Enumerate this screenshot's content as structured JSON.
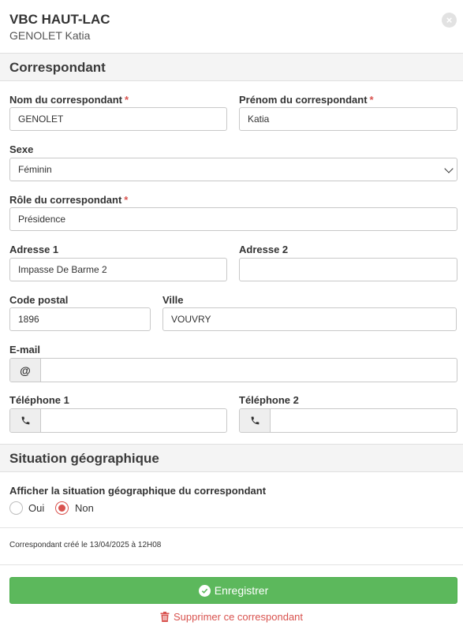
{
  "header": {
    "title": "VBC HAUT-LAC",
    "subtitle": "GENOLET Katia",
    "close_label": "×"
  },
  "sections": {
    "correspondant": "Correspondant",
    "geo": "Situation géographique"
  },
  "form": {
    "nom_label": "Nom du correspondant",
    "nom_value": "GENOLET",
    "prenom_label": "Prénom du correspondant",
    "prenom_value": "Katia",
    "sexe_label": "Sexe",
    "sexe_value": "Féminin",
    "role_label": "Rôle du correspondant",
    "role_value": "Présidence",
    "adresse1_label": "Adresse 1",
    "adresse1_value": "Impasse De Barme 2",
    "adresse2_label": "Adresse 2",
    "adresse2_value": "",
    "cp_label": "Code postal",
    "cp_value": "1896",
    "ville_label": "Ville",
    "ville_value": "VOUVRY",
    "email_label": "E-mail",
    "email_value": "",
    "email_addon": "@",
    "tel1_label": "Téléphone 1",
    "tel1_value": "",
    "tel2_label": "Téléphone 2",
    "tel2_value": "",
    "required_mark": "*"
  },
  "geo": {
    "question": "Afficher la situation géographique du correspondant",
    "option_oui": "Oui",
    "option_non": "Non",
    "selected": "Non"
  },
  "footer": {
    "created": "Correspondant créé le 13/04/2025 à 12H08",
    "save_label": "Enregistrer",
    "delete_label": "Supprimer ce correspondant"
  },
  "colors": {
    "save": "#5cb85c",
    "danger": "#d9534f",
    "section_bg": "#f4f4f4"
  },
  "icons": {
    "close": "close-icon",
    "email": "at-icon",
    "phone": "phone-icon",
    "save": "check-circle-icon",
    "delete": "trash-icon",
    "select": "chevron-down-icon"
  }
}
